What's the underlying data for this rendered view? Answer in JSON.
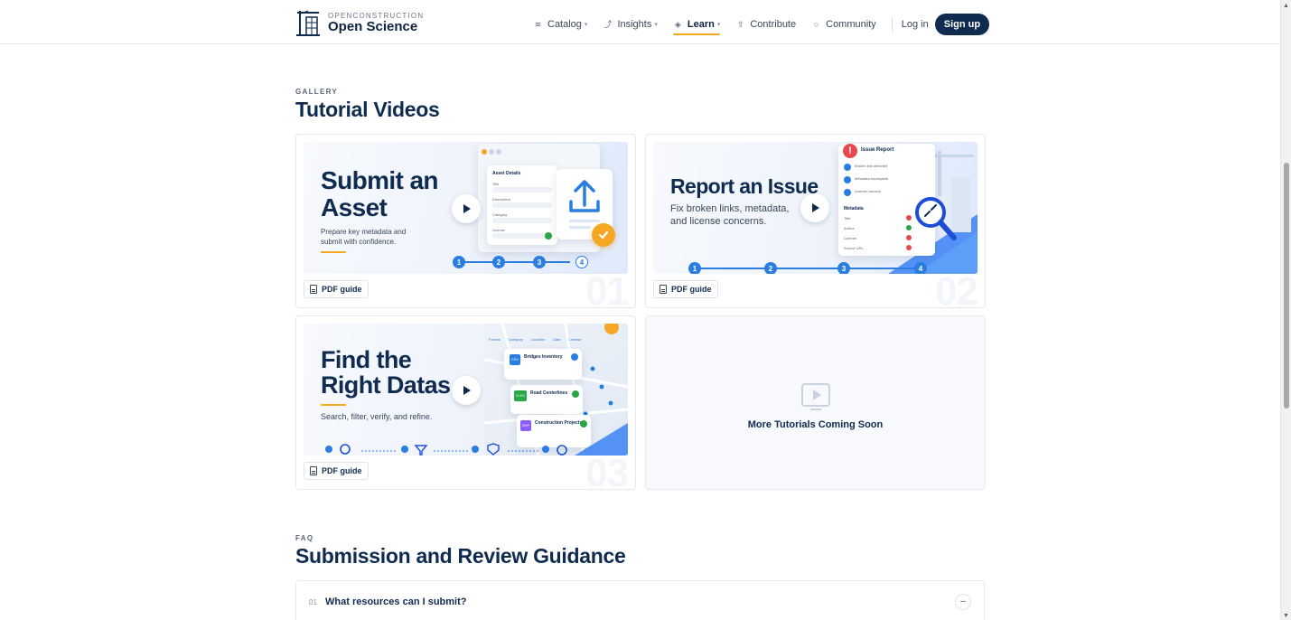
{
  "header": {
    "brand_small": "OPENCONSTRUCTION",
    "brand_big": "Open Science",
    "nav": [
      {
        "label": "Catalog",
        "icon": "layers-icon",
        "has_dropdown": true,
        "active": false
      },
      {
        "label": "Insights",
        "icon": "trend-icon",
        "has_dropdown": true,
        "active": false
      },
      {
        "label": "Learn",
        "icon": "graduation-cap-icon",
        "has_dropdown": true,
        "active": true
      },
      {
        "label": "Contribute",
        "icon": "upload-icon",
        "has_dropdown": false,
        "active": false
      },
      {
        "label": "Community",
        "icon": "user-icon",
        "has_dropdown": false,
        "active": false
      }
    ],
    "login": "Log in",
    "signup": "Sign up"
  },
  "gallery": {
    "eyebrow": "GALLERY",
    "title": "Tutorial Videos",
    "cards": [
      {
        "title_line1": "Submit an",
        "title_line2": "Asset",
        "subtitle_line1": "Prepare key metadata and",
        "subtitle_line2": "submit with confidence.",
        "pdf_label": "PDF guide",
        "number": "01",
        "mock_title": "Asset Details",
        "mock_fields": [
          "Title",
          "Description",
          "Category",
          "License"
        ]
      },
      {
        "title_line1": "Report an Issue",
        "subtitle_line1": "Fix broken links, metadata,",
        "subtitle_line2": "and license concerns.",
        "pdf_label": "PDF guide",
        "number": "02",
        "mock_title": "Issue Report",
        "mock_checks": [
          "Broken link detected",
          "Metadata incomplete",
          "License concern"
        ],
        "mock_meta_title": "Metadata",
        "mock_meta": [
          "Title",
          "Author",
          "License",
          "Source URL"
        ]
      },
      {
        "title_line1": "Find the",
        "title_line2": "Right Datas",
        "subtitle_line1": "Search, filter, verify, and refine.",
        "pdf_label": "PDF guide",
        "number": "03",
        "filters": [
          "Format",
          "Category",
          "Location",
          "Date",
          "License"
        ],
        "results": [
          {
            "badge": "CSV",
            "name": "Bridges Inventory",
            "badge_color": "#2a7de1"
          },
          {
            "badge": "XLSX",
            "name": "Road Centerlines",
            "badge_color": "#27a745"
          },
          {
            "badge": "SHP",
            "name": "Construction Projects",
            "badge_color": "#8b5cf6"
          }
        ]
      }
    ],
    "coming_soon": "More Tutorials Coming Soon"
  },
  "faq": {
    "eyebrow": "FAQ",
    "title": "Submission and Review Guidance",
    "items": [
      {
        "num": "01",
        "question": "What resources can I submit?",
        "toggle": "–"
      }
    ]
  },
  "colors": {
    "navy": "#0f2b4f",
    "accent": "#f5a623",
    "blue": "#2a7de1"
  }
}
